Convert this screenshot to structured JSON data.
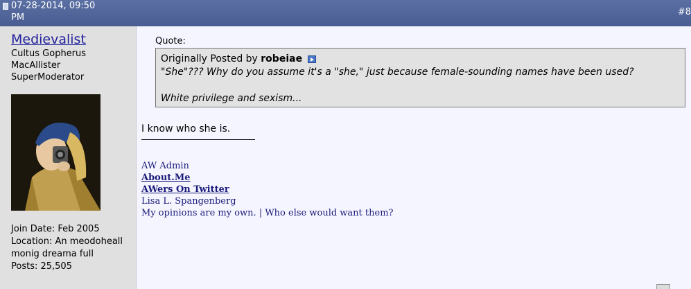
{
  "header": {
    "date_line1": "07-28-2014, 09:50",
    "date_line2": "PM",
    "post_number": "#8"
  },
  "user": {
    "name": "Medievalist",
    "titles": [
      "Cultus Gopherus",
      "MacAllister",
      "SuperModerator"
    ],
    "join_date": "Join Date: Feb 2005",
    "location_line1": "Location: An meodoheall",
    "location_line2": "monig dreama full",
    "posts": "Posts: 25,505"
  },
  "quote": {
    "label": "Quote:",
    "originally_posted_by": "Originally Posted by",
    "author": "robeiae",
    "line1": "\"She\"??? Why do you assume it's a \"she,\" just because female-sounding names have been used?",
    "line2": "White privilege and sexism..."
  },
  "message": "I know who she is.",
  "signature": {
    "line1": "AW Admin",
    "link1": "About.Me",
    "link2": "AWers On Twitter",
    "line4": "Lisa L. Spangenberg",
    "line5": "My opinions are my own. | Who else would want them?"
  }
}
